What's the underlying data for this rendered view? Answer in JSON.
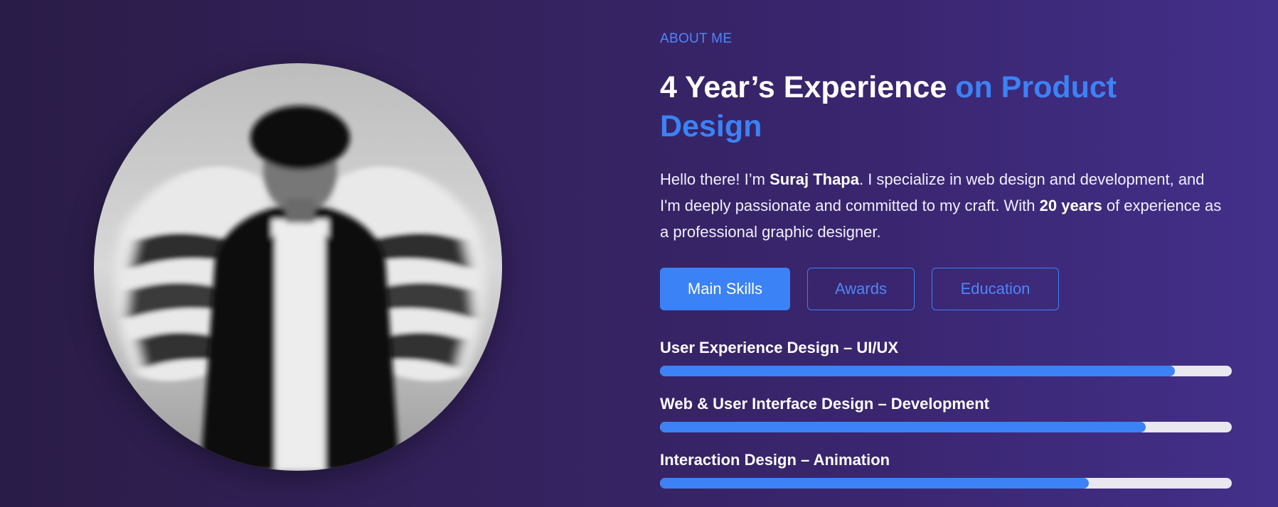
{
  "about": {
    "eyebrow": "ABOUT ME",
    "headline_main": "4 Year’s Experience ",
    "headline_accent": "on Product Design",
    "intro_prefix": "Hello there! I’m ",
    "intro_name": "Suraj Thapa",
    "intro_middle": ". I specialize in web design and development, and I'm deeply passionate and committed to my craft. With ",
    "intro_years": "20 years",
    "intro_suffix": " of experience as a professional graphic designer."
  },
  "tabs": [
    {
      "label": "Main Skills",
      "active": true
    },
    {
      "label": "Awards",
      "active": false
    },
    {
      "label": "Education",
      "active": false
    }
  ],
  "skills": [
    {
      "label": "User Experience Design – UI/UX",
      "progress": 0.9
    },
    {
      "label": "Web & User Interface Design – Development",
      "progress": 0.85
    },
    {
      "label": "Interaction Design – Animation",
      "progress": 0.75
    }
  ],
  "colors": {
    "accent": "#3b82f6",
    "background_start": "#2a1c47",
    "background_end": "#43308a",
    "track": "#e9e8ef"
  },
  "icons": {
    "portrait": "portrait-photo"
  }
}
